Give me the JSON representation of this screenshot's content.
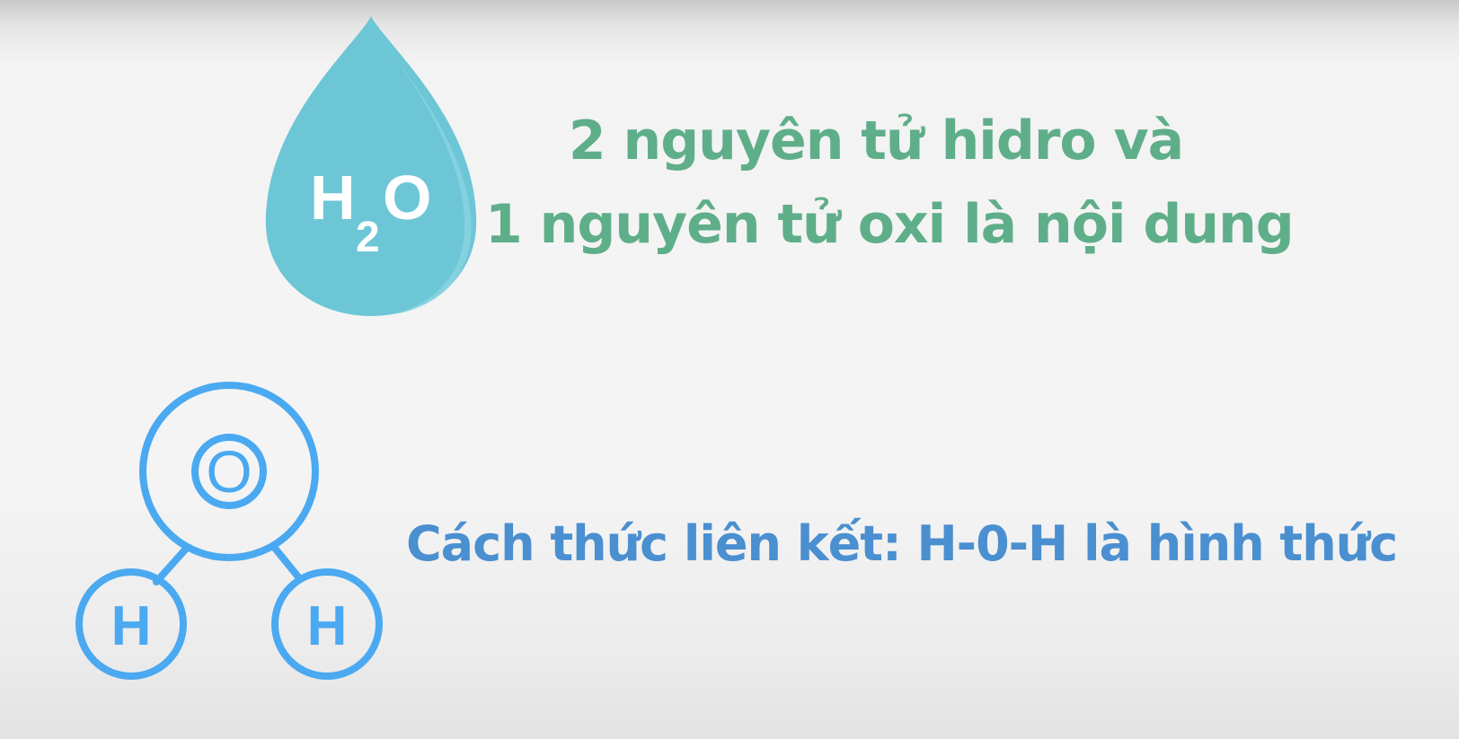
{
  "drop": {
    "symbol_h": "H",
    "symbol_sub": "2",
    "symbol_o": "O"
  },
  "molecule": {
    "oxygen_label": "O",
    "hydrogen_left_label": "H",
    "hydrogen_right_label": "H"
  },
  "headline": {
    "line1": "2 nguyên tử hidro và",
    "line2": "1 nguyên tử oxi là nội dung"
  },
  "bond": {
    "text": "Cách thức liên kết: H-0-H là hình thức"
  },
  "colors": {
    "drop_fill": "#6cc6d6",
    "drop_highlight": "#8fd6e2",
    "headline_text": "#5fae8a",
    "molecule_stroke": "#4aa9f0",
    "bond_text": "#4a8fd0",
    "white": "#ffffff"
  }
}
